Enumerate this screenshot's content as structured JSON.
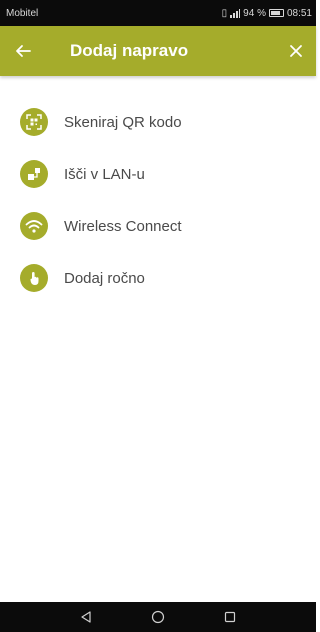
{
  "status_bar": {
    "carrier": "Mobitel",
    "battery_percent": "94 %",
    "time": "08:51"
  },
  "app_bar": {
    "title": "Dodaj napravo",
    "back_icon": "arrow-left-icon",
    "close_icon": "close-icon",
    "color": "#a5ac2b"
  },
  "menu": {
    "items": [
      {
        "label": "Skeniraj QR kodo",
        "icon": "qr-scan-icon"
      },
      {
        "label": "Išči v LAN-u",
        "icon": "lan-search-icon"
      },
      {
        "label": "Wireless Connect",
        "icon": "wifi-icon"
      },
      {
        "label": "Dodaj ročno",
        "icon": "hand-touch-icon"
      }
    ]
  },
  "nav_bar": {
    "buttons": [
      "back-triangle-icon",
      "home-circle-icon",
      "recents-square-icon"
    ]
  }
}
